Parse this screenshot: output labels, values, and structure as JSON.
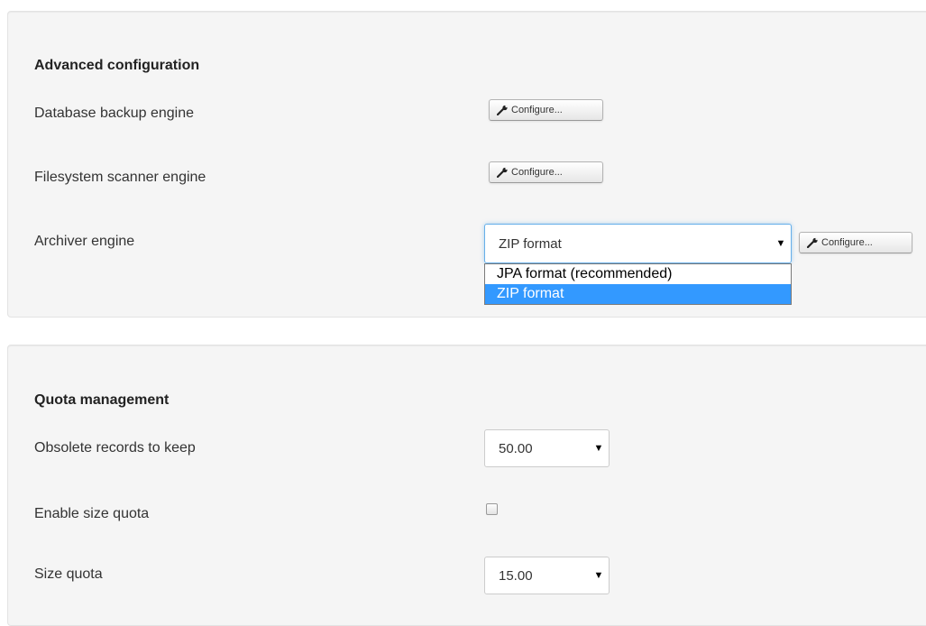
{
  "advanced": {
    "heading": "Advanced configuration",
    "db_backup_label": "Database backup engine",
    "fs_scanner_label": "Filesystem scanner engine",
    "archiver_label": "Archiver engine",
    "configure_label": "Configure...",
    "archiver_select": {
      "value": "ZIP format",
      "options": [
        "JPA format (recommended)",
        "ZIP format"
      ],
      "selected_index": 1
    }
  },
  "quota": {
    "heading": "Quota management",
    "obsolete_label": "Obsolete records to keep",
    "obsolete_value": "50.00",
    "size_quota_enable_label": "Enable size quota",
    "size_quota_enabled": false,
    "size_quota_label": "Size quota",
    "size_quota_value": "15.00"
  },
  "icons": {
    "configure": "wrench-icon",
    "select_arrow": "triangle-down-icon"
  },
  "colors": {
    "panel_bg": "#f5f5f5",
    "focus_border": "#66afe9",
    "selected_option": "#3399ff"
  }
}
